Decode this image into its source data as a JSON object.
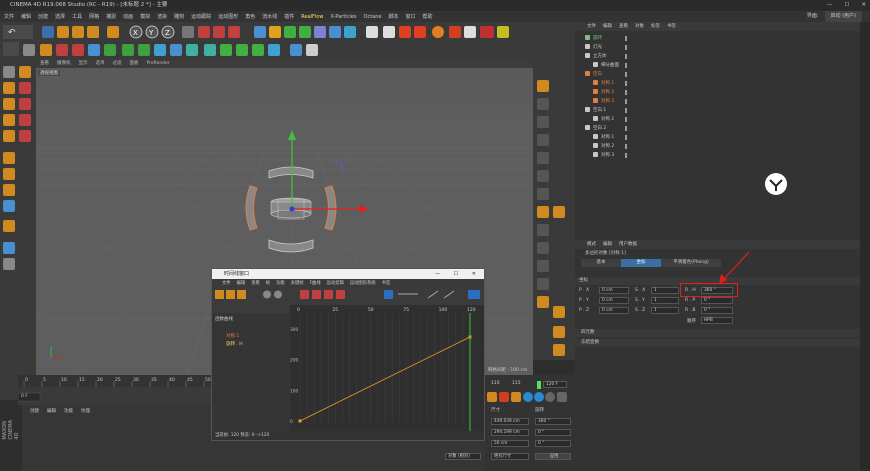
{
  "app": {
    "title": "CINEMA 4D R19.068 Studio (RC - R19) - [未标题 2 *] - 主要",
    "window_min": "—",
    "window_max": "☐",
    "window_close": "✕"
  },
  "menubar": {
    "items": [
      "文件",
      "编辑",
      "创建",
      "选择",
      "工具",
      "网格",
      "捕捉",
      "动画",
      "模拟",
      "渲染",
      "雕刻",
      "运动跟踪",
      "运动图形",
      "角色",
      "流水线",
      "插件",
      "RealFlow",
      "X-Particles",
      "Octane",
      "脚本",
      "窗口",
      "帮助"
    ],
    "highlight": "RealFlow",
    "right_label": "界面:",
    "right_value": "启动 (用户)"
  },
  "viewport": {
    "menu": [
      "查看",
      "摄像机",
      "显示",
      "选项",
      "过滤",
      "面板",
      "ProRender"
    ],
    "label": "透视视图",
    "grid_label": "网格间距：100 cm"
  },
  "objects": {
    "menu": [
      "文件",
      "编辑",
      "查看",
      "对象",
      "标签",
      "书签"
    ],
    "rows": [
      {
        "name": "圆环",
        "indent": 0,
        "color": "#7fbf7f"
      },
      {
        "name": "灯光",
        "indent": 0,
        "color": "#c8c8c8"
      },
      {
        "name": "立方体",
        "indent": 0,
        "color": "#c8c8c8"
      },
      {
        "name": "细分曲面",
        "indent": 1,
        "color": "#c8c8c8"
      },
      {
        "name": "空白",
        "indent": 0,
        "color": "#e08040"
      },
      {
        "name": "对称.1",
        "indent": 1,
        "color": "#e08040"
      },
      {
        "name": "对称.2",
        "indent": 1,
        "color": "#e08040"
      },
      {
        "name": "对称.3",
        "indent": 1,
        "color": "#e08040"
      },
      {
        "name": "空白.1",
        "indent": 0,
        "color": "#c8c8c8"
      },
      {
        "name": "对称.1",
        "indent": 1,
        "color": "#c8c8c8"
      },
      {
        "name": "空白.2",
        "indent": 0,
        "color": "#c8c8c8"
      },
      {
        "name": "对称.1",
        "indent": 1,
        "color": "#c8c8c8"
      },
      {
        "name": "对称.2",
        "indent": 1,
        "color": "#c8c8c8"
      },
      {
        "name": "对称.3",
        "indent": 1,
        "color": "#c8c8c8"
      }
    ]
  },
  "attributes": {
    "menu": [
      "模式",
      "编辑",
      "用户数据"
    ],
    "object_title": "多边形对象 [对称.1]",
    "tabs": [
      "基本",
      "坐标",
      "平滑着色(Phong)"
    ],
    "active_tab": "坐标",
    "section": "坐标",
    "pos": {
      "x": "0 cm",
      "y": "0 cm",
      "z": "0 cm"
    },
    "scale": {
      "x": "1",
      "y": "1",
      "z": "1"
    },
    "rot": {
      "h": "360 °",
      "p": "0 °",
      "b": "0 °"
    },
    "order_label": "顺序",
    "order_value": "HPB",
    "freeze": "冻结变换",
    "extra": "四元数"
  },
  "timeline": {
    "title": "时间线窗口",
    "menu": [
      "文件",
      "编辑",
      "查看",
      "帧",
      "功能",
      "关键帧",
      "F曲线",
      "运动剪辑",
      "运动图形系统",
      "书签"
    ],
    "mode_label": "函数曲线",
    "tracks": [
      {
        "name": "对称.1"
      },
      {
        "name": "旋转 . H"
      }
    ],
    "ruler": [
      0,
      25,
      50,
      75,
      100,
      120
    ],
    "value_ticks": [
      "300",
      "200",
      "100",
      "0"
    ],
    "status": "当前帧: 120  预览: 0-->120",
    "track_label": "网格间距 : 100 cm",
    "current_frame_label": "120"
  },
  "main_timeline": {
    "ticks": [
      0,
      5,
      10,
      15,
      20,
      25,
      30,
      35,
      40,
      45,
      50,
      55,
      60,
      65,
      70,
      75,
      80,
      85,
      90,
      95,
      100,
      105,
      110,
      115
    ],
    "start": "0 F",
    "end": "120 F",
    "current": "120 F"
  },
  "material": {
    "menu": [
      "创建",
      "编辑",
      "功能",
      "纹理"
    ]
  },
  "coords": {
    "size_label": "尺寸",
    "rot_label": "旋转",
    "x": "449.039 cm",
    "y": "294.199 cm",
    "z": "50 cm",
    "sx": "360 °",
    "sy": "0 °",
    "sz": "0 °",
    "mode1": "对象 (相对)",
    "mode2": "绝对尺寸",
    "apply": "应用"
  },
  "brand": {
    "side": "MAXON CINEMA 4D"
  }
}
